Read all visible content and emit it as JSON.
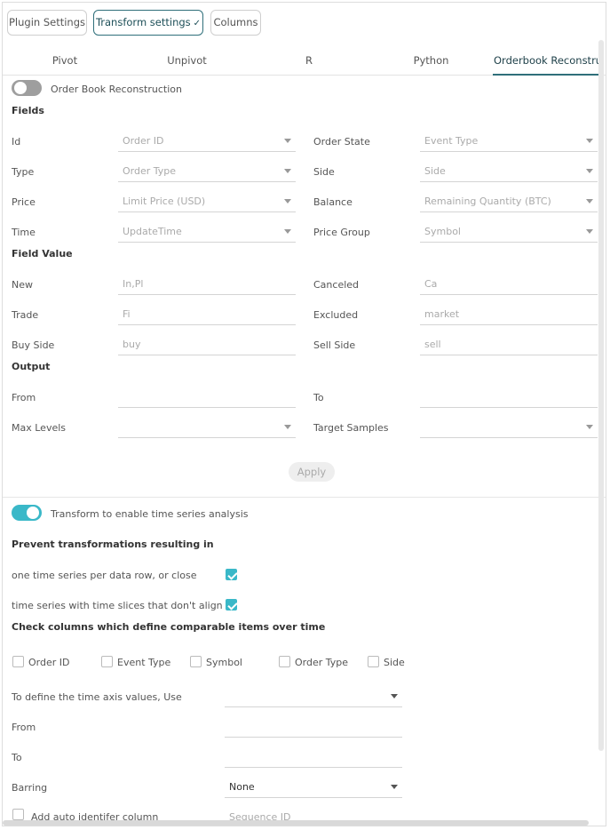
{
  "top_tabs": [
    {
      "label": "Plugin Settings"
    },
    {
      "label": "Transform settings",
      "check": "✓"
    },
    {
      "label": "Columns"
    }
  ],
  "sub_tabs": [
    "Pivot",
    "Unpivot",
    "R",
    "Python",
    "Orderbook Reconstruction"
  ],
  "orderbook": {
    "toggle_label": "Order Book Reconstruction",
    "fields_heading": "Fields",
    "fields": {
      "id": {
        "label": "Id",
        "value": "Order ID"
      },
      "order_state": {
        "label": "Order State",
        "value": "Event Type"
      },
      "type": {
        "label": "Type",
        "value": "Order Type"
      },
      "side": {
        "label": "Side",
        "value": "Side"
      },
      "price": {
        "label": "Price",
        "value": "Limit Price (USD)"
      },
      "balance": {
        "label": "Balance",
        "value": "Remaining Quantity (BTC)"
      },
      "time": {
        "label": "Time",
        "value": "UpdateTime"
      },
      "price_group": {
        "label": "Price Group",
        "value": "Symbol"
      }
    },
    "field_value_heading": "Field Value",
    "field_values": {
      "new": {
        "label": "New",
        "value": "In,Pl"
      },
      "canceled": {
        "label": "Canceled",
        "value": "Ca"
      },
      "trade": {
        "label": "Trade",
        "value": "Fi"
      },
      "excluded": {
        "label": "Excluded",
        "value": "market"
      },
      "buy_side": {
        "label": "Buy Side",
        "value": "buy"
      },
      "sell_side": {
        "label": "Sell Side",
        "value": "sell"
      }
    },
    "output_heading": "Output",
    "output": {
      "from": {
        "label": "From",
        "value": ""
      },
      "to": {
        "label": "To",
        "value": ""
      },
      "max_levels": {
        "label": "Max Levels",
        "value": ""
      },
      "target_samples": {
        "label": "Target Samples",
        "value": ""
      }
    },
    "apply_label": "Apply"
  },
  "timeseries": {
    "toggle_label": "Transform to enable time series analysis",
    "prevent_heading": "Prevent transformations resulting in",
    "prevent_options": [
      {
        "label": "one time series per data row, or close",
        "checked": true
      },
      {
        "label": "time series with time slices that don't align",
        "checked": true
      }
    ],
    "check_heading": "Check columns which define comparable items over time",
    "columns": [
      "Order ID",
      "Event Type",
      "Symbol",
      "Order Type",
      "Side"
    ],
    "time_axis_label": "To define the time axis values, Use",
    "time_axis_value": "",
    "from_label": "From",
    "to_label": "To",
    "barring_label": "Barring",
    "barring_value": "None",
    "auto_id_label": "Add auto identifer column",
    "auto_id_value": "Sequence ID"
  },
  "colors": {
    "accent": "#3ab8c8",
    "tab_active": "#2f6f7a"
  }
}
